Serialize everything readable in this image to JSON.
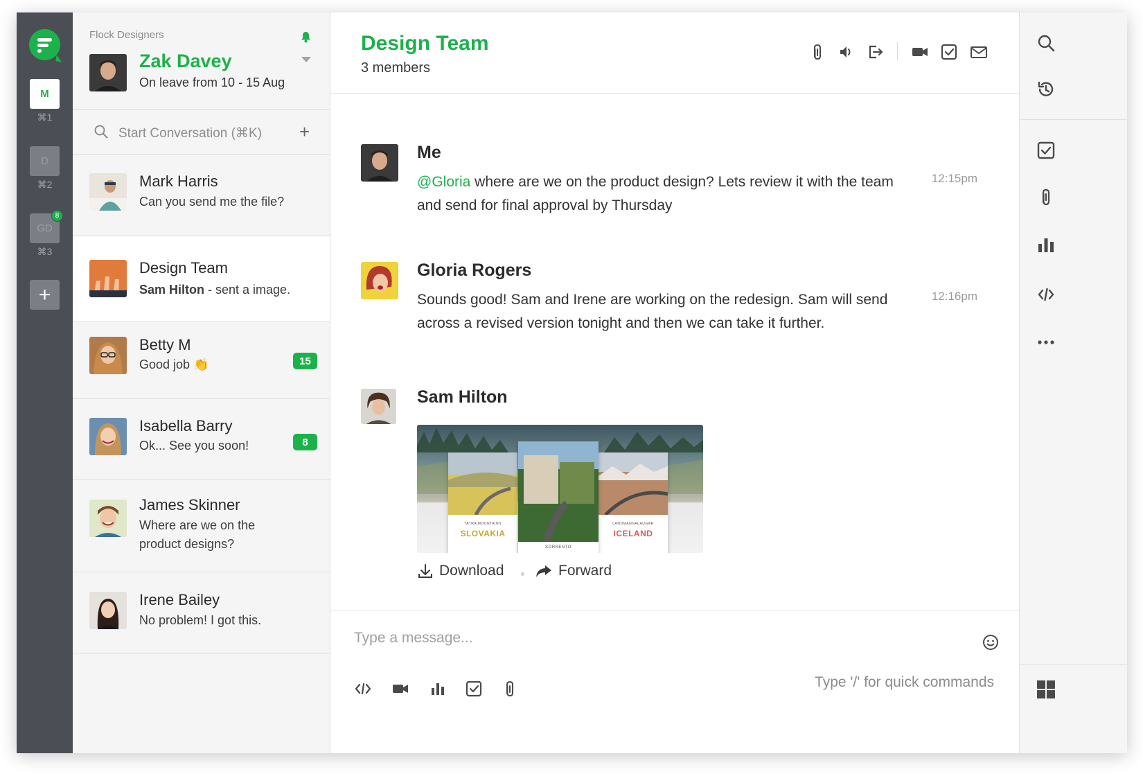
{
  "rail": {
    "teams": [
      {
        "initials": "M",
        "shortcut": "⌘1",
        "active": true
      },
      {
        "initials": "D",
        "shortcut": "⌘2",
        "active": false
      },
      {
        "initials": "GD",
        "shortcut": "⌘3",
        "active": false,
        "badge": "8"
      }
    ],
    "add_label": "+"
  },
  "profile": {
    "team_name": "Flock Designers",
    "user_name": "Zak Davey",
    "status": "On leave from 10 - 15 Aug"
  },
  "search": {
    "placeholder": "Start Conversation (⌘K)",
    "plus_label": "+"
  },
  "conversations": [
    {
      "name": "Mark Harris",
      "message": "Can you send me the file?",
      "unread": ""
    },
    {
      "name": "Design Team",
      "sender": "Sam Hilton",
      "message": " - sent a image.",
      "unread": "",
      "active": true
    },
    {
      "name": "Betty M",
      "message": "Good job",
      "emoji": "👏",
      "unread": "15"
    },
    {
      "name": "Isabella Barry",
      "message": "Ok... See you soon!",
      "unread": "8"
    },
    {
      "name": "James Skinner",
      "message": "Where are we on the product designs?",
      "unread": ""
    },
    {
      "name": "Irene Bailey",
      "message": "No problem! I got this.",
      "unread": ""
    }
  ],
  "chat": {
    "title": "Design Team",
    "subtitle": "3 members",
    "header_icons": [
      "attachment-icon",
      "mute-icon",
      "leave-icon",
      "video-call-icon",
      "todo-icon",
      "email-icon"
    ],
    "messages": [
      {
        "sender": "Me",
        "mention": "@Gloria",
        "text": " where are we on the product design? Lets review it with the team and send for final approval by Thursday",
        "time": "12:15pm"
      },
      {
        "sender": "Gloria Rogers",
        "text": "Sounds good! Sam and Irene are working on the redesign. Sam will send across a revised version tonight and then we can take it further.",
        "time": "12:16pm"
      },
      {
        "sender": "Sam Hilton",
        "attachment": {
          "cards": [
            {
              "label": "SLOVAKIA",
              "caption": "TATRA MOUNTAINS"
            },
            {
              "label": "",
              "caption": "SORRENTO"
            },
            {
              "label": "ICELAND",
              "caption": "LANDMANNALAUGAR"
            }
          ]
        },
        "actions": {
          "download": "Download",
          "forward": "Forward"
        }
      }
    ]
  },
  "composer": {
    "placeholder": "Type a message...",
    "hint": "Type '/' for quick commands",
    "tools": [
      "code-snippet-icon",
      "video-icon",
      "poll-icon",
      "todo-icon",
      "attachment-icon"
    ]
  },
  "right_rail": {
    "icons": [
      "search-icon",
      "history-icon",
      "todo-icon",
      "files-icon",
      "polls-icon",
      "code-icon",
      "more-icon",
      "apps-grid-icon"
    ]
  },
  "colors": {
    "accent": "#1cb24b",
    "rail": "#4b4f55",
    "list_bg": "#f5f5f5"
  }
}
